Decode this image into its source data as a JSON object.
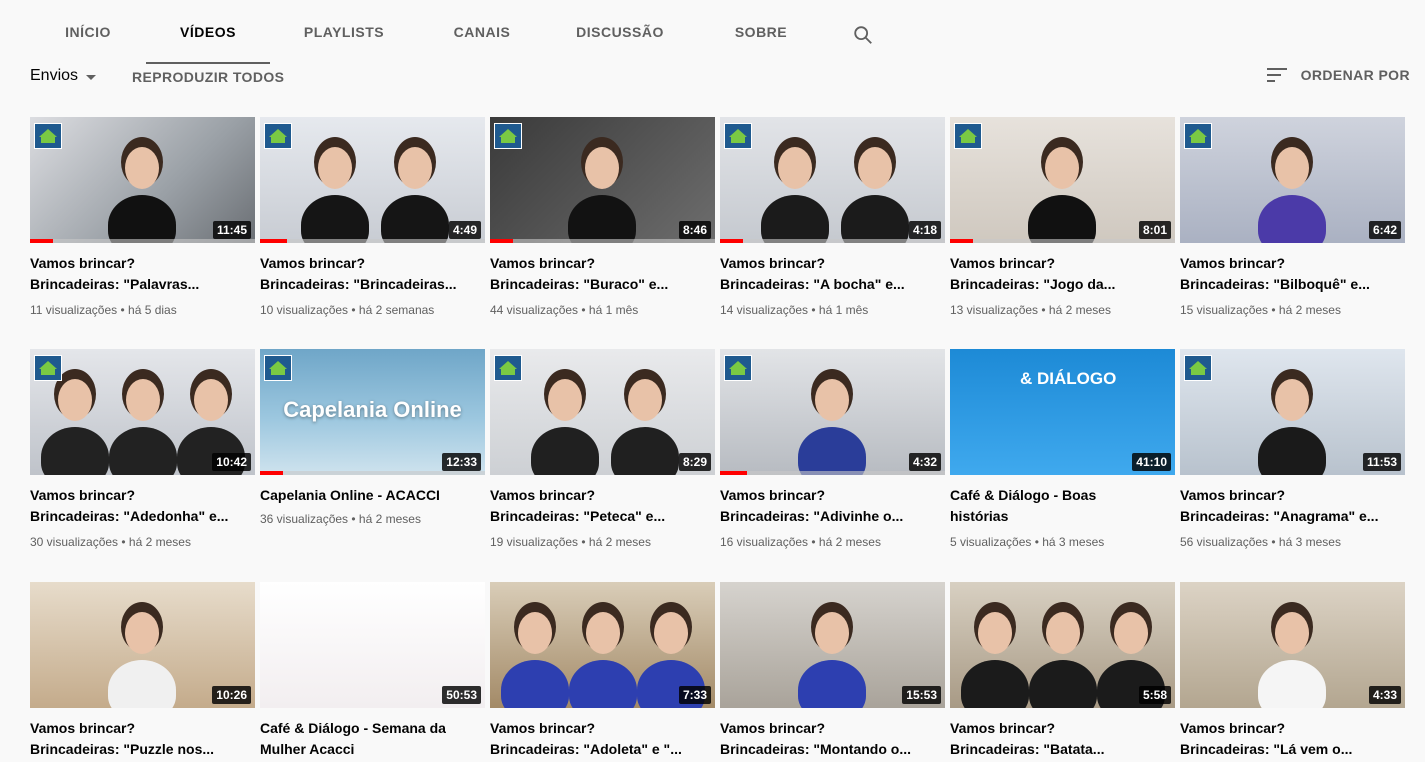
{
  "tabs": [
    {
      "label": "INÍCIO",
      "active": false
    },
    {
      "label": "VÍDEOS",
      "active": true
    },
    {
      "label": "PLAYLISTS",
      "active": false
    },
    {
      "label": "CANAIS",
      "active": false
    },
    {
      "label": "DISCUSSÃO",
      "active": false
    },
    {
      "label": "SOBRE",
      "active": false
    }
  ],
  "search_icon": "search-icon",
  "toolbar": {
    "envios_label": "Envios",
    "play_all_label": "REPRODUZIR TODOS",
    "sort_label": "ORDENAR POR"
  },
  "videos": [
    {
      "line1": "Vamos brincar?",
      "line2": "Brincadeiras: \"Palavras...",
      "meta": "11 visualizações • há 5 dias",
      "duration": "11:45",
      "progress": 0.1
    },
    {
      "line1": "Vamos brincar?",
      "line2": "Brincadeiras: \"Brincadeiras...",
      "meta": "10 visualizações • há 2 semanas",
      "duration": "4:49",
      "progress": 0.12
    },
    {
      "line1": "Vamos brincar?",
      "line2": "Brincadeiras: \"Buraco\" e...",
      "meta": "44 visualizações • há 1 mês",
      "duration": "8:46",
      "progress": 0.1
    },
    {
      "line1": "Vamos brincar?",
      "line2": "Brincadeiras: \"A bocha\" e...",
      "meta": "14 visualizações • há 1 mês",
      "duration": "4:18",
      "progress": 0.1
    },
    {
      "line1": "Vamos brincar?",
      "line2": "Brincadeiras: \"Jogo da...",
      "meta": "13 visualizações • há 2 meses",
      "duration": "8:01",
      "progress": 0.1
    },
    {
      "line1": "Vamos brincar?",
      "line2": "Brincadeiras: \"Bilboquê\" e...",
      "meta": "15 visualizações • há 2 meses",
      "duration": "6:42",
      "progress": 0
    },
    {
      "line1": "Vamos brincar?",
      "line2": "Brincadeiras: \"Adedonha\" e...",
      "meta": "30 visualizações • há 2 meses",
      "duration": "10:42",
      "progress": 0
    },
    {
      "line1": "Capelania Online - ACACCI",
      "line2": "",
      "meta": "36 visualizações • há 2 meses",
      "duration": "12:33",
      "progress": 0.1,
      "overlay": "Capelania Online"
    },
    {
      "line1": "Vamos brincar?",
      "line2": "Brincadeiras: \"Peteca\" e...",
      "meta": "19 visualizações • há 2 meses",
      "duration": "8:29",
      "progress": 0
    },
    {
      "line1": "Vamos brincar?",
      "line2": "Brincadeiras: \"Adivinhe o...",
      "meta": "16 visualizações • há 2 meses",
      "duration": "4:32",
      "progress": 0.12
    },
    {
      "line1": "Café & Diálogo - Boas",
      "line2": "histórias",
      "meta": "5 visualizações • há 3 meses",
      "duration": "41:10",
      "progress": 0,
      "overlay": "& DIÁLOGO"
    },
    {
      "line1": "Vamos brincar?",
      "line2": "Brincadeiras: \"Anagrama\" e...",
      "meta": "56 visualizações • há 3 meses",
      "duration": "11:53",
      "progress": 0
    },
    {
      "line1": "Vamos brincar?",
      "line2": "Brincadeiras: \"Puzzle nos...",
      "meta": "",
      "duration": "10:26",
      "progress": 0
    },
    {
      "line1": "Café & Diálogo - Semana da",
      "line2": "Mulher Acacci",
      "meta": "",
      "duration": "50:53",
      "progress": 0
    },
    {
      "line1": "Vamos brincar?",
      "line2": "Brincadeiras: \"Adoleta\" e \"...",
      "meta": "",
      "duration": "7:33",
      "progress": 0
    },
    {
      "line1": "Vamos brincar?",
      "line2": "Brincadeiras: \"Montando o...",
      "meta": "",
      "duration": "15:53",
      "progress": 0
    },
    {
      "line1": "Vamos brincar?",
      "line2": "Brincadeiras: \"Batata...",
      "meta": "",
      "duration": "5:58",
      "progress": 0
    },
    {
      "line1": "Vamos brincar?",
      "line2": "Brincadeiras: \"Lá vem o...",
      "meta": "",
      "duration": "4:33",
      "progress": 0
    }
  ]
}
